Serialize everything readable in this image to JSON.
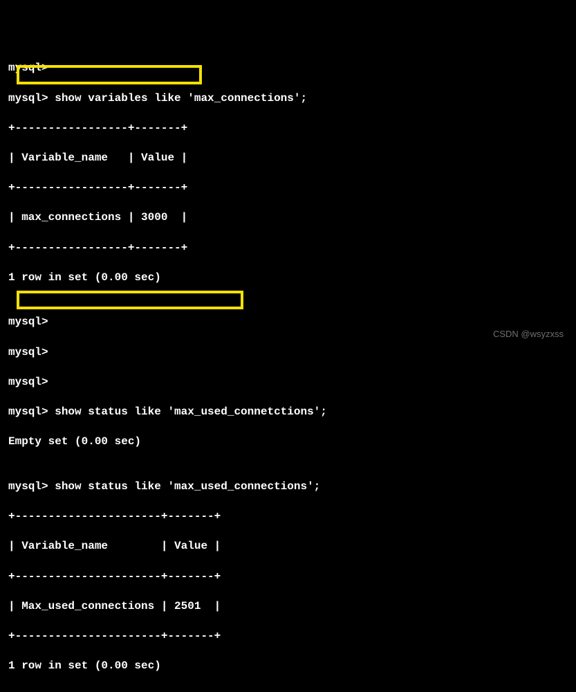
{
  "lines": {
    "l00": "mysql>",
    "l01": "mysql> show variables like 'max_connections';",
    "l02": "+-----------------+-------+",
    "l03": "| Variable_name   | Value |",
    "l04": "+-----------------+-------+",
    "l05": "| max_connections | 3000  |",
    "l06": "+-----------------+-------+",
    "l07": "1 row in set (0.00 sec)",
    "l08": "",
    "l09": "mysql>",
    "l10": "mysql>",
    "l11": "mysql>",
    "l12": "mysql> show status like 'max_used_connetctions';",
    "l13": "Empty set (0.00 sec)",
    "l14": "",
    "l15": "mysql> show status like 'max_used_connections';",
    "l16": "+----------------------+-------+",
    "l17": "| Variable_name        | Value |",
    "l18": "+----------------------+-------+",
    "l19": "| Max_used_connections | 2501  |",
    "l20": "+----------------------+-------+",
    "l21": "1 row in set (0.00 sec)"
  },
  "watermark": "CSDN @wsyzxss"
}
